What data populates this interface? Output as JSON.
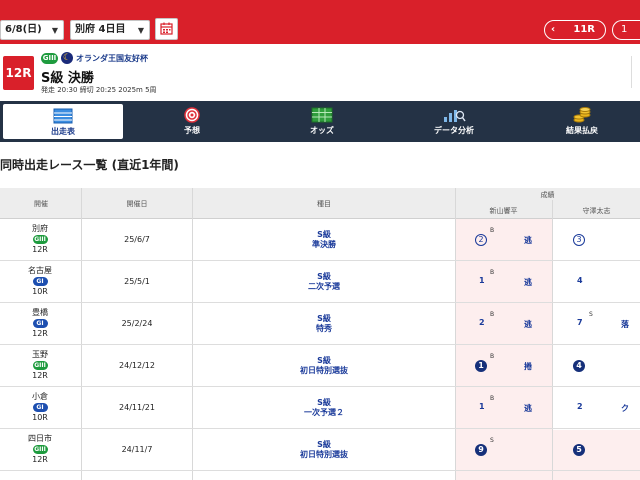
{
  "topbar": {
    "date_select": "6/8(日)",
    "venue_select": "別府 4日目",
    "prev_race": "11R",
    "next_race": "1"
  },
  "race": {
    "number": "12R",
    "grade": "GIII",
    "name_sub": "オランダ王国友好杯",
    "title": "S級 決勝",
    "meta": "発走 20:30 締切 20:25 2025m 5周"
  },
  "nav": [
    {
      "label": "出走表",
      "icon": "table-icon"
    },
    {
      "label": "予想",
      "icon": "target-icon"
    },
    {
      "label": "オッズ",
      "icon": "odds-board-icon"
    },
    {
      "label": "データ分析",
      "icon": "chart-icon"
    },
    {
      "label": "結果払戻",
      "icon": "coins-icon"
    }
  ],
  "section": {
    "title": "同時出走レース一覧 (直近1年間)"
  },
  "table": {
    "headers": {
      "venue": "開催",
      "date": "開催日",
      "type": "種目",
      "results": "成績",
      "rider1": "新山響平",
      "rider2": "守澤太志"
    },
    "rows": [
      {
        "venue": "別府",
        "grade": "GIII",
        "race": "12R",
        "date": "25/6/7",
        "type1": "S級",
        "type2": "準決勝",
        "r1": "2",
        "r1_sup": "B",
        "r1_kimari": "逃",
        "r1_style": "circle",
        "r2": "3",
        "r2_sup": "",
        "r2_kimari": "",
        "r2_style": "circle"
      },
      {
        "venue": "名古屋",
        "grade": "GI",
        "race": "10R",
        "date": "25/5/1",
        "type1": "S級",
        "type2": "二次予選",
        "r1": "1",
        "r1_sup": "B",
        "r1_kimari": "逃",
        "r1_style": "plain",
        "r2": "4",
        "r2_sup": "",
        "r2_kimari": "",
        "r2_style": "plain"
      },
      {
        "venue": "豊橋",
        "grade": "GI",
        "race": "12R",
        "date": "25/2/24",
        "type1": "S級",
        "type2": "特秀",
        "r1": "2",
        "r1_sup": "B",
        "r1_kimari": "逃",
        "r1_style": "plain",
        "r2": "7",
        "r2_sup": "S",
        "r2_kimari": "落",
        "r2_style": "plain"
      },
      {
        "venue": "玉野",
        "grade": "GIII",
        "race": "12R",
        "date": "24/12/12",
        "type1": "S級",
        "type2": "初日特別選抜",
        "r1": "1",
        "r1_sup": "B",
        "r1_kimari": "捲",
        "r1_style": "filled",
        "r2": "4",
        "r2_sup": "",
        "r2_kimari": "",
        "r2_style": "filled"
      },
      {
        "venue": "小倉",
        "grade": "GI",
        "race": "10R",
        "date": "24/11/21",
        "type1": "S級",
        "type2": "一次予選２",
        "r1": "1",
        "r1_sup": "B",
        "r1_kimari": "逃",
        "r1_style": "plain",
        "r2": "2",
        "r2_sup": "",
        "r2_kimari": "ク",
        "r2_style": "plain"
      },
      {
        "venue": "四日市",
        "grade": "GIII",
        "race": "12R",
        "date": "24/11/7",
        "type1": "S級",
        "type2": "初日特別選抜",
        "r1": "9",
        "r1_sup": "S",
        "r1_kimari": "",
        "r1_style": "filled",
        "r2": "5",
        "r2_sup": "",
        "r2_kimari": "",
        "r2_style": "filled"
      }
    ]
  }
}
